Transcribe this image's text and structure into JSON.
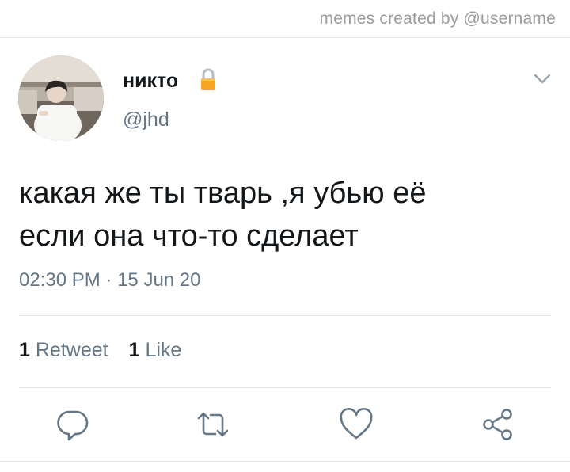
{
  "header": {
    "credit": "memes created by @username"
  },
  "tweet": {
    "display_name": "никто",
    "handle": "@jhd",
    "text_lines": [
      "какая же ты тварь ,я убью её",
      "если она что-то сделает"
    ],
    "time": "02:30 PM",
    "date": "15 Jun 20",
    "separator": "·",
    "retweet_count": "1",
    "retweet_label": "Retweet",
    "like_count": "1",
    "like_label": "Like"
  },
  "icons": {
    "lock": "lock-icon",
    "menu": "chevron-down-icon",
    "reply": "reply-icon",
    "retweet": "retweet-icon",
    "like": "heart-icon",
    "share": "share-icon"
  },
  "colors": {
    "text": "#14171a",
    "secondary": "#657786",
    "divider": "#e1e8ed",
    "lock": "#f5a623"
  }
}
